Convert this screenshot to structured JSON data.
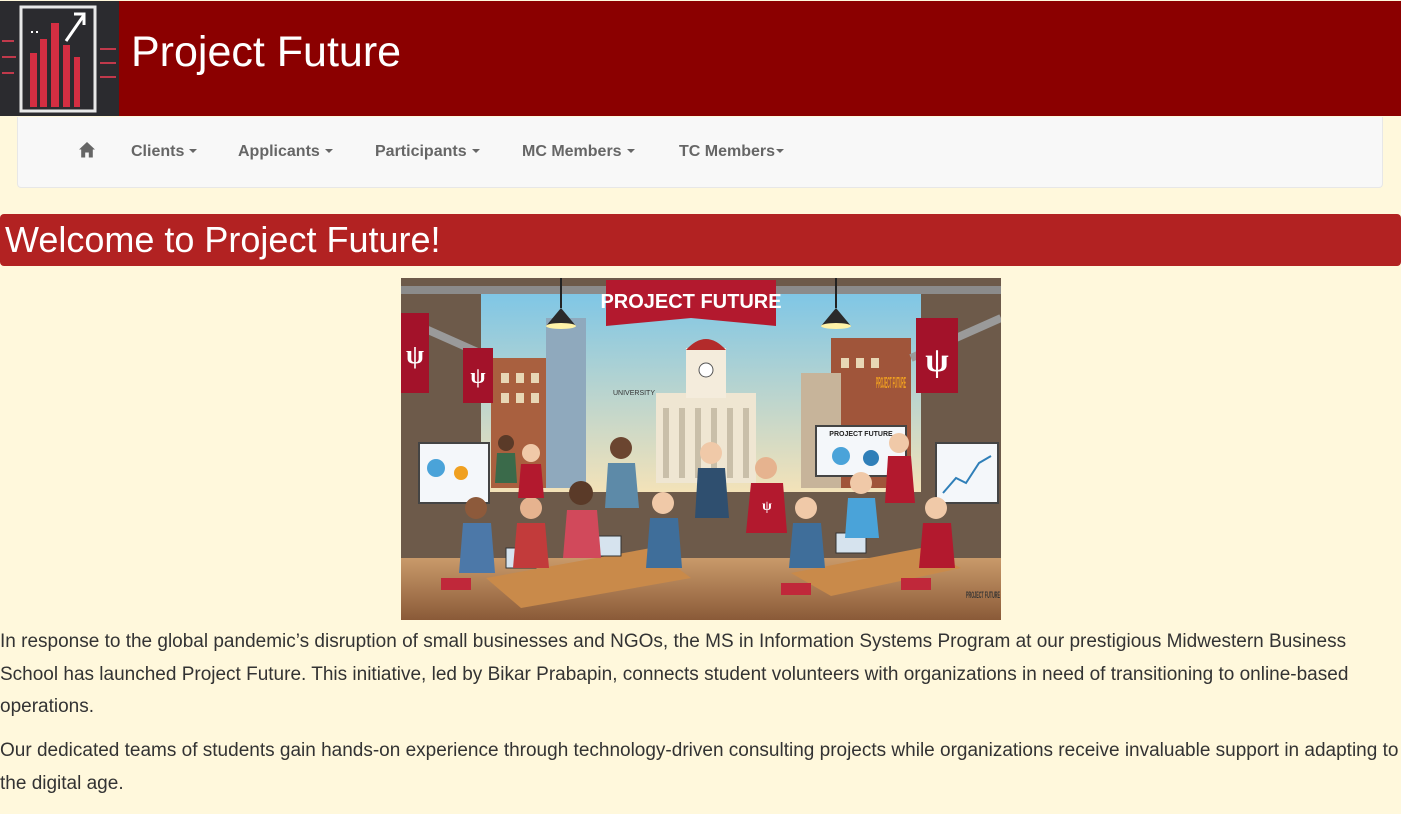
{
  "header": {
    "title": "Project Future",
    "logo_icon": "bar-chart-growth-logo"
  },
  "nav": {
    "home_icon": "home-icon",
    "items": [
      {
        "label": "Clients"
      },
      {
        "label": "Applicants"
      },
      {
        "label": "Participants"
      },
      {
        "label": "MC Members"
      },
      {
        "label": "TC Members"
      }
    ]
  },
  "welcome": {
    "heading": "Welcome to Project Future!"
  },
  "hero": {
    "banner_text": "PROJECT FUTURE",
    "building_label": "UNIVERSITY",
    "board_text": "PROJECT FUTURE",
    "wall_text": "PROJECT FUTURE",
    "corner_text": "PROJECT FUTURE"
  },
  "content": {
    "paragraph1": "In response to the global pandemic’s disruption of small businesses and NGOs, the MS in Information Systems Program at our prestigious Midwestern Business School has launched Project Future. This initiative, led by Bikar Prabapin, connects student volunteers with organizations in need of transitioning to online-based operations.",
    "paragraph2": "Our dedicated teams of students gain hands-on experience through technology-driven consulting projects while organizations receive invaluable support in adapting to the digital age."
  },
  "colors": {
    "header_bg": "#8b0000",
    "welcome_bg": "#b22222",
    "page_bg": "#fff8dc",
    "nav_bg": "#f8f8f8",
    "nav_text": "#666666"
  }
}
